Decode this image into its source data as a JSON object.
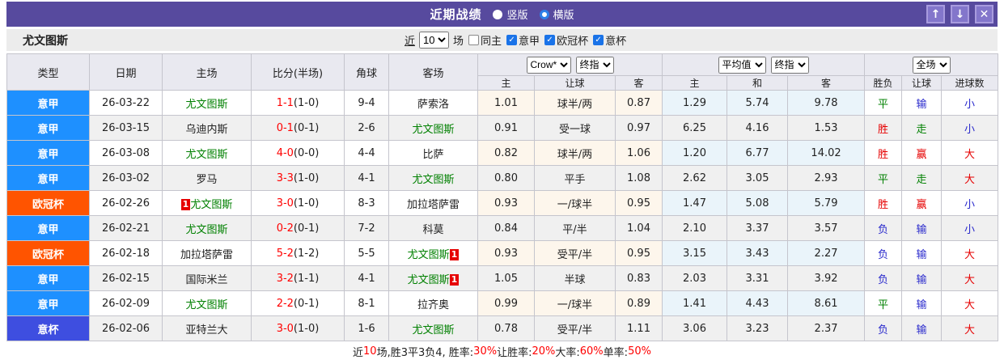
{
  "titlebar": {
    "title": "近期战绩",
    "radios": [
      {
        "label": "竖版",
        "checked": false
      },
      {
        "label": "横版",
        "checked": true
      }
    ],
    "buttons": [
      {
        "name": "move-up-button",
        "icon_name": "arrow-up-icon",
        "glyph": "↑"
      },
      {
        "name": "move-down-button",
        "icon_name": "arrow-down-icon",
        "glyph": "↓"
      },
      {
        "name": "close-button",
        "icon_name": "close-icon",
        "glyph": "✕"
      }
    ]
  },
  "filterbar": {
    "team": "尤文图斯",
    "recent_label": "近",
    "recent_value": "10",
    "games_label": "场",
    "checkboxes": [
      {
        "label": "同主",
        "checked": false
      },
      {
        "label": "意甲",
        "checked": true
      },
      {
        "label": "欧冠杯",
        "checked": true
      },
      {
        "label": "意杯",
        "checked": true
      }
    ]
  },
  "table": {
    "columns": [
      "类型",
      "日期",
      "主场",
      "比分(半场)",
      "角球",
      "客场"
    ],
    "odds_groups": [
      {
        "selects": [
          "Crow*",
          "终指"
        ],
        "select_names": [
          "bookmaker-select",
          "odds-stage-select"
        ],
        "subcols": [
          "主",
          "让球",
          "客"
        ]
      },
      {
        "selects": [
          "平均值",
          "终指"
        ],
        "select_names": [
          "average-select",
          "europe-stage-select"
        ],
        "subcols": [
          "主",
          "和",
          "客"
        ]
      },
      {
        "selects": [
          "全场"
        ],
        "select_names": [
          "period-select"
        ],
        "subcols": [
          "胜负",
          "让球",
          "进球数"
        ]
      }
    ],
    "rows": [
      {
        "league": "意甲",
        "lc": "serie_a",
        "date": "26-03-22",
        "home": {
          "name": "尤文图斯",
          "juve": true,
          "card": ""
        },
        "score": "1-1",
        "half": "(1-0)",
        "corner": "9-4",
        "away": {
          "name": "萨索洛",
          "juve": false,
          "card": ""
        },
        "odds": [
          "1.01",
          "球半/两",
          "0.87",
          "1.29",
          "5.74",
          "9.78"
        ],
        "results": [
          {
            "t": "平",
            "c": "green"
          },
          {
            "t": "输",
            "c": "blue"
          },
          {
            "t": "小",
            "c": "blue"
          }
        ]
      },
      {
        "league": "意甲",
        "lc": "serie_a",
        "date": "26-03-15",
        "home": {
          "name": "乌迪内斯",
          "juve": false,
          "card": ""
        },
        "score": "0-1",
        "half": "(0-1)",
        "corner": "2-6",
        "away": {
          "name": "尤文图斯",
          "juve": true,
          "card": ""
        },
        "odds": [
          "0.91",
          "受一球",
          "0.97",
          "6.25",
          "4.16",
          "1.53"
        ],
        "results": [
          {
            "t": "胜",
            "c": "red"
          },
          {
            "t": "走",
            "c": "green"
          },
          {
            "t": "小",
            "c": "blue"
          }
        ]
      },
      {
        "league": "意甲",
        "lc": "serie_a",
        "date": "26-03-08",
        "home": {
          "name": "尤文图斯",
          "juve": true,
          "card": ""
        },
        "score": "4-0",
        "half": "(0-0)",
        "corner": "4-4",
        "away": {
          "name": "比萨",
          "juve": false,
          "card": ""
        },
        "odds": [
          "0.82",
          "球半/两",
          "1.06",
          "1.20",
          "6.77",
          "14.02"
        ],
        "results": [
          {
            "t": "胜",
            "c": "red"
          },
          {
            "t": "赢",
            "c": "red"
          },
          {
            "t": "大",
            "c": "red"
          }
        ]
      },
      {
        "league": "意甲",
        "lc": "serie_a",
        "date": "26-03-02",
        "home": {
          "name": "罗马",
          "juve": false,
          "card": ""
        },
        "score": "3-3",
        "half": "(1-0)",
        "corner": "4-1",
        "away": {
          "name": "尤文图斯",
          "juve": true,
          "card": ""
        },
        "odds": [
          "0.80",
          "平手",
          "1.08",
          "2.62",
          "3.05",
          "2.93"
        ],
        "results": [
          {
            "t": "平",
            "c": "green"
          },
          {
            "t": "走",
            "c": "green"
          },
          {
            "t": "大",
            "c": "red"
          }
        ]
      },
      {
        "league": "欧冠杯",
        "lc": "ucl",
        "date": "26-02-26",
        "home": {
          "name": "尤文图斯",
          "juve": true,
          "card": "1"
        },
        "score": "3-0",
        "half": "(1-0)",
        "corner": "8-3",
        "away": {
          "name": "加拉塔萨雷",
          "juve": false,
          "card": ""
        },
        "odds": [
          "0.93",
          "一/球半",
          "0.95",
          "1.47",
          "5.08",
          "5.79"
        ],
        "results": [
          {
            "t": "胜",
            "c": "red"
          },
          {
            "t": "赢",
            "c": "red"
          },
          {
            "t": "小",
            "c": "blue"
          }
        ]
      },
      {
        "league": "意甲",
        "lc": "serie_a",
        "date": "26-02-21",
        "home": {
          "name": "尤文图斯",
          "juve": true,
          "card": ""
        },
        "score": "0-2",
        "half": "(0-1)",
        "corner": "7-2",
        "away": {
          "name": "科莫",
          "juve": false,
          "card": ""
        },
        "odds": [
          "0.84",
          "平/半",
          "1.04",
          "2.10",
          "3.37",
          "3.57"
        ],
        "results": [
          {
            "t": "负",
            "c": "blue"
          },
          {
            "t": "输",
            "c": "blue"
          },
          {
            "t": "小",
            "c": "blue"
          }
        ]
      },
      {
        "league": "欧冠杯",
        "lc": "ucl",
        "date": "26-02-18",
        "home": {
          "name": "加拉塔萨雷",
          "juve": false,
          "card": ""
        },
        "score": "5-2",
        "half": "(1-2)",
        "corner": "5-5",
        "away": {
          "name": "尤文图斯",
          "juve": true,
          "card": "1"
        },
        "odds": [
          "0.93",
          "受平/半",
          "0.95",
          "3.15",
          "3.43",
          "2.27"
        ],
        "results": [
          {
            "t": "负",
            "c": "blue"
          },
          {
            "t": "输",
            "c": "blue"
          },
          {
            "t": "大",
            "c": "red"
          }
        ]
      },
      {
        "league": "意甲",
        "lc": "serie_a",
        "date": "26-02-15",
        "home": {
          "name": "国际米兰",
          "juve": false,
          "card": ""
        },
        "score": "3-2",
        "half": "(1-1)",
        "corner": "4-1",
        "away": {
          "name": "尤文图斯",
          "juve": true,
          "card": "1"
        },
        "odds": [
          "1.05",
          "半球",
          "0.83",
          "2.03",
          "3.31",
          "3.92"
        ],
        "results": [
          {
            "t": "负",
            "c": "blue"
          },
          {
            "t": "输",
            "c": "blue"
          },
          {
            "t": "大",
            "c": "red"
          }
        ]
      },
      {
        "league": "意甲",
        "lc": "serie_a",
        "date": "26-02-09",
        "home": {
          "name": "尤文图斯",
          "juve": true,
          "card": ""
        },
        "score": "2-2",
        "half": "(0-1)",
        "corner": "8-1",
        "away": {
          "name": "拉齐奥",
          "juve": false,
          "card": ""
        },
        "odds": [
          "0.99",
          "一/球半",
          "0.89",
          "1.41",
          "4.43",
          "8.61"
        ],
        "results": [
          {
            "t": "平",
            "c": "green"
          },
          {
            "t": "输",
            "c": "blue"
          },
          {
            "t": "大",
            "c": "red"
          }
        ]
      },
      {
        "league": "意杯",
        "lc": "coppa",
        "date": "26-02-06",
        "home": {
          "name": "亚特兰大",
          "juve": false,
          "card": ""
        },
        "score": "3-0",
        "half": "(1-0)",
        "corner": "1-6",
        "away": {
          "name": "尤文图斯",
          "juve": true,
          "card": ""
        },
        "odds": [
          "0.78",
          "受平/半",
          "1.11",
          "3.06",
          "3.23",
          "2.37"
        ],
        "results": [
          {
            "t": "负",
            "c": "blue"
          },
          {
            "t": "输",
            "c": "blue"
          },
          {
            "t": "大",
            "c": "red"
          }
        ]
      }
    ]
  },
  "footer": {
    "segments": [
      {
        "t": "近",
        "c": "k"
      },
      {
        "t": "10",
        "c": "r"
      },
      {
        "t": "场,胜3平3负4, 胜率:",
        "c": "k"
      },
      {
        "t": "30%",
        "c": "r"
      },
      {
        "t": " 让胜率:",
        "c": "k"
      },
      {
        "t": "20%",
        "c": "r"
      },
      {
        "t": " 大率:",
        "c": "k"
      },
      {
        "t": "60%",
        "c": "r"
      },
      {
        "t": " 单率:",
        "c": "k"
      },
      {
        "t": "50%",
        "c": "r"
      }
    ]
  },
  "colors": {
    "accent": "#574a9e",
    "league": {
      "serie_a": "#1e90ff",
      "ucl": "#ff5400",
      "coppa": "#3e4ee0"
    },
    "juve_green": "#008000",
    "red": "#e60000",
    "green": "#008000",
    "blue": "#2929cc",
    "score_red": "#ff0000",
    "checkbox_blue": "#1a73e8"
  }
}
